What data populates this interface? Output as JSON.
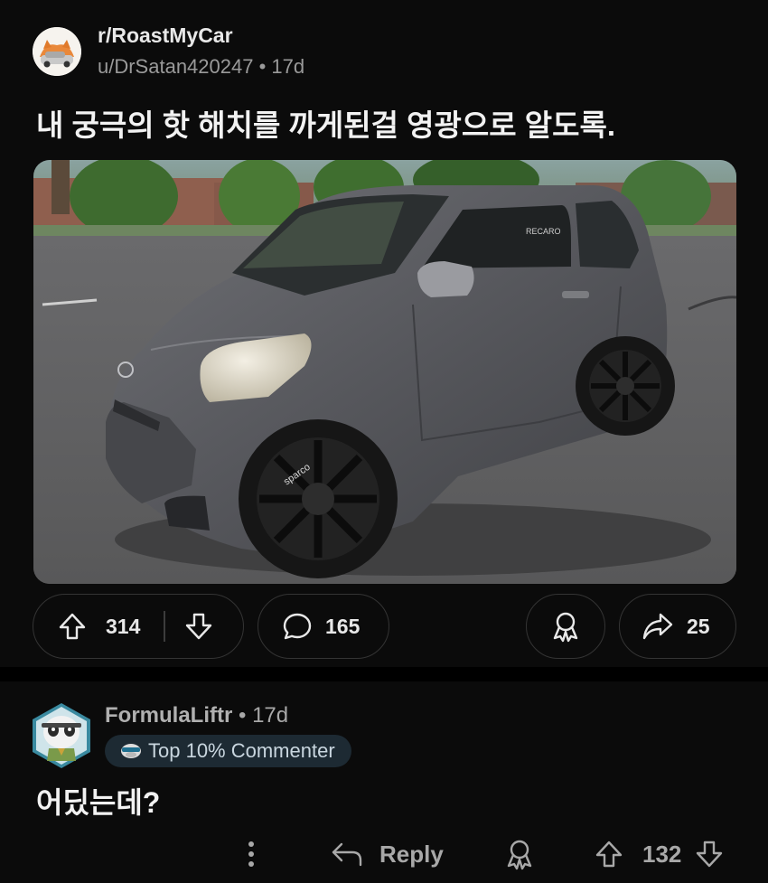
{
  "post": {
    "subreddit": "r/RoastMyCar",
    "author": "u/DrSatan420247",
    "time": "17d",
    "title": "내 궁극의 핫 해치를 까게된걸 영광으로 알도록.",
    "image": {
      "wheel_brand": "sparco",
      "seat_brand": "RECARO"
    },
    "upvotes": "314",
    "comments": "165",
    "shares": "25",
    "icons": {
      "upvote": "upvote-arrow-icon",
      "downvote": "downvote-arrow-icon",
      "comment": "comment-bubble-icon",
      "award": "award-ribbon-icon",
      "share": "share-arrow-icon"
    }
  },
  "comment": {
    "author": "FormulaLiftr",
    "time": "17d",
    "flair": "Top 10% Commenter",
    "text": "어딨는데?",
    "reply_label": "Reply",
    "votes": "132",
    "icons": {
      "more": "more-vertical-icon",
      "reply": "reply-arrow-icon",
      "award": "award-ribbon-icon",
      "upvote": "upvote-arrow-icon",
      "downvote": "downvote-arrow-icon"
    }
  },
  "colors": {
    "background": "#0b0b0b",
    "separator": "#000000",
    "pill_border": "#343434",
    "text_primary": "#f2f2f2",
    "text_secondary": "#9a9a9a",
    "flair_bg": "#1d2a33"
  }
}
